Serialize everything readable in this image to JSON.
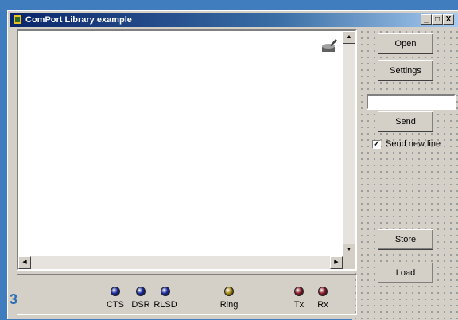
{
  "window": {
    "title": "ComPort Library example"
  },
  "titlebar_buttons": {
    "minimize": "_",
    "maximize": "□",
    "close": "X"
  },
  "toolbar": {
    "icon": "comport-component-icon"
  },
  "buttons": {
    "open": "Open",
    "settings": "Settings",
    "send": "Send",
    "store": "Store",
    "load": "Load"
  },
  "send_input": {
    "value": ""
  },
  "send_new_line": {
    "label": "Send new line",
    "checked": true,
    "mark": "✓"
  },
  "status_leds": [
    {
      "label": "CTS",
      "color": "#1a2a9c"
    },
    {
      "label": "DSR",
      "color": "#1a2a9c"
    },
    {
      "label": "RLSD",
      "color": "#1a2a9c"
    },
    {
      "label": "Ring",
      "color": "#a88a10"
    },
    {
      "label": "Tx",
      "color": "#8a1a2a"
    },
    {
      "label": "Rx",
      "color": "#8a1a2a"
    }
  ],
  "page_number": "3",
  "colors": {
    "background": "#3f7dbe",
    "titlebar": "#0a246a",
    "badge": "#2e6eb3"
  }
}
